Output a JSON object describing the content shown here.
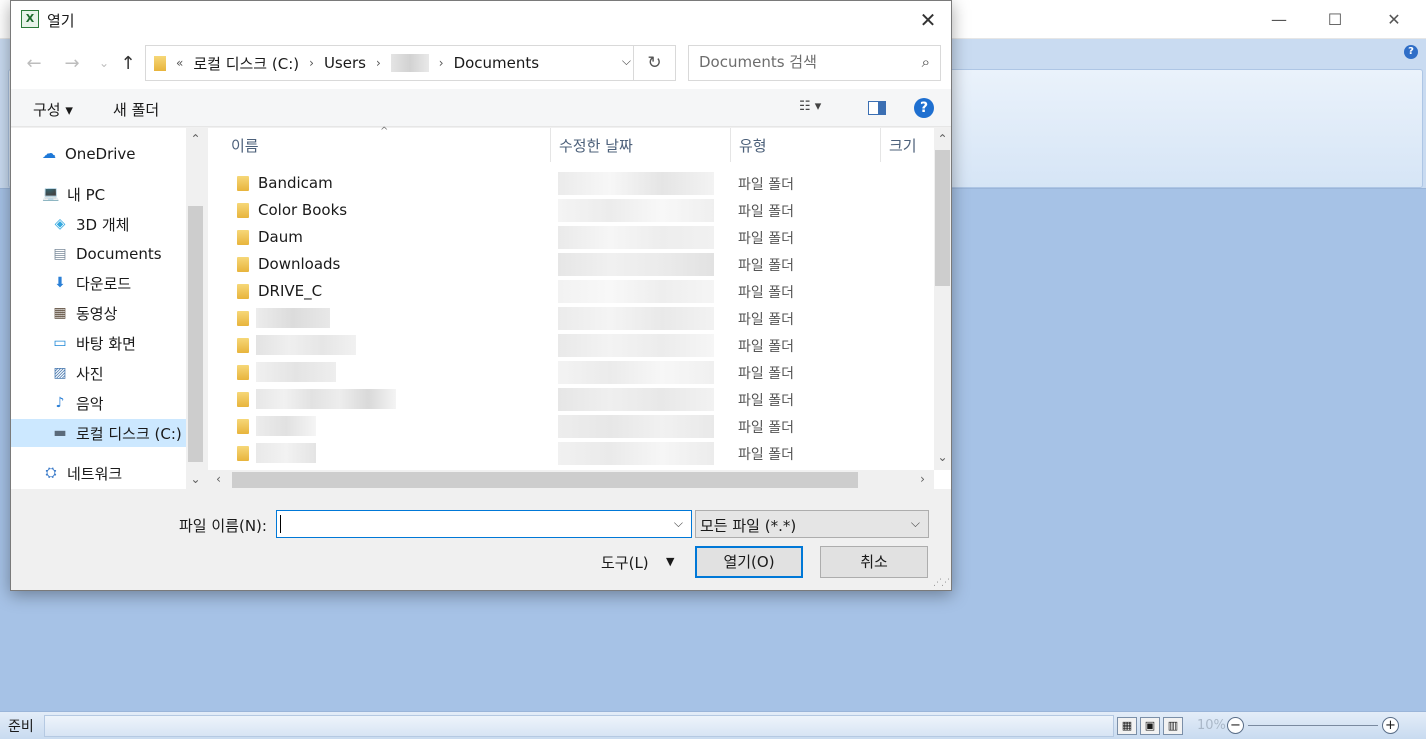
{
  "background_app": {
    "controls": {
      "minimize": "—",
      "maximize": "☐",
      "close": "✕"
    },
    "help": "?",
    "status": "준비",
    "zoom_label": "10%",
    "zoom_minus": "−",
    "zoom_plus": "+"
  },
  "dialog": {
    "title": "열기",
    "app_icon": "X",
    "close_glyph": "✕",
    "nav": {
      "back": "←",
      "forward": "→",
      "recent": "⌄",
      "up": "↑"
    },
    "address": {
      "overflow": "«",
      "crumbs": [
        "로컬 디스크 (C:)",
        "Users",
        "Documents"
      ],
      "sep": "›",
      "refresh": "↻"
    },
    "search_placeholder": "Documents 검색",
    "search_icon": "⌕",
    "toolbar": {
      "organize": "구성 ▾",
      "new_folder": "새 폴더",
      "view_glyph": "☷ ▾",
      "help": "?"
    },
    "nav_pane": {
      "items": [
        {
          "label": "OneDrive",
          "icon": "cloud-icon",
          "glyph": "☁"
        },
        {
          "label": "내 PC",
          "icon": "computer-icon",
          "glyph": "💻"
        },
        {
          "label": "3D 개체",
          "icon": "cube-icon",
          "glyph": "◈"
        },
        {
          "label": "Documents",
          "icon": "document-icon",
          "glyph": "▤"
        },
        {
          "label": "다운로드",
          "icon": "download-icon",
          "glyph": "⬇"
        },
        {
          "label": "동영상",
          "icon": "video-icon",
          "glyph": "▦"
        },
        {
          "label": "바탕 화면",
          "icon": "desktop-icon",
          "glyph": "▭"
        },
        {
          "label": "사진",
          "icon": "picture-icon",
          "glyph": "▨"
        },
        {
          "label": "음악",
          "icon": "music-icon",
          "glyph": "♪"
        },
        {
          "label": "로컬 디스크 (C:)",
          "icon": "drive-icon",
          "glyph": "▬"
        },
        {
          "label": "네트워크",
          "icon": "network-icon",
          "glyph": "⛭"
        }
      ]
    },
    "columns": {
      "name": "이름",
      "modified": "수정한 날짜",
      "type": "유형",
      "size": "크기"
    },
    "files": [
      {
        "name": "Bandicam",
        "type": "파일 폴더"
      },
      {
        "name": "Color Books",
        "type": "파일 폴더"
      },
      {
        "name": "Daum",
        "type": "파일 폴더"
      },
      {
        "name": "Downloads",
        "type": "파일 폴더"
      },
      {
        "name": "DRIVE_C",
        "type": "파일 폴더"
      },
      {
        "name": "",
        "type": "파일 폴더"
      },
      {
        "name": "",
        "type": "파일 폴더"
      },
      {
        "name": "",
        "type": "파일 폴더"
      },
      {
        "name": "",
        "type": "파일 폴더"
      },
      {
        "name": "",
        "type": "파일 폴더"
      },
      {
        "name": "",
        "type": "파일 폴더"
      }
    ],
    "filename_label": "파일 이름(N):",
    "filename_value": "",
    "filetype_value": "모든 파일 (*.*)",
    "tools_label": "도구(L)",
    "open_label": "열기(O)",
    "cancel_label": "취소",
    "colors": {
      "accent": "#0078d7",
      "selection": "#cce8ff",
      "folder": "#e8b43c"
    }
  }
}
